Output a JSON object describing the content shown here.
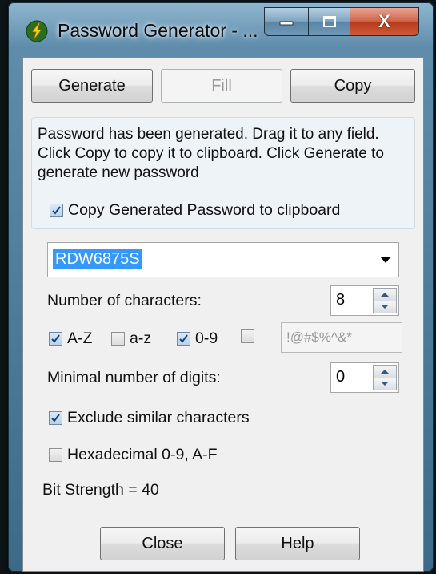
{
  "window": {
    "title": "Password Generator - ...",
    "caption_close": "X"
  },
  "toolbar": {
    "generate_label": "Generate",
    "fill_label": "Fill",
    "copy_label": "Copy"
  },
  "info": {
    "message": "Password has been generated. Drag it to any field. Click Copy to copy it to clipboard. Click Generate to generate new password",
    "copy_to_clipboard_label": "Copy Generated Password to clipboard",
    "copy_to_clipboard_checked": true
  },
  "password": {
    "value": "RDW6875S"
  },
  "options": {
    "num_chars_label": "Number of characters:",
    "num_chars_value": "8",
    "az_label": "A-Z",
    "az_checked": true,
    "lower_label": "a-z",
    "lower_checked": false,
    "digits_label": "0-9",
    "digits_checked": true,
    "symbols_checked": false,
    "symbols_value": "!@#$%^&*",
    "min_digits_label": "Minimal number of digits:",
    "min_digits_value": "0",
    "exclude_similar_label": "Exclude similar characters",
    "exclude_similar_checked": true,
    "hex_label": "Hexadecimal 0-9, A-F",
    "hex_checked": false,
    "bit_strength": "Bit Strength = 40"
  },
  "footer": {
    "close_label": "Close",
    "help_label": "Help"
  },
  "colors": {
    "selection": "#3399ff",
    "close_button": "#c8472a",
    "window_frame": "#5f8cab"
  },
  "icons": {
    "app": "lightning-bolt-icon",
    "minimize": "minimize-icon",
    "maximize": "maximize-icon",
    "close": "close-icon",
    "dropdown": "chevron-down-icon",
    "spin_up": "spin-up-icon",
    "spin_down": "spin-down-icon",
    "check": "checkmark-icon"
  }
}
